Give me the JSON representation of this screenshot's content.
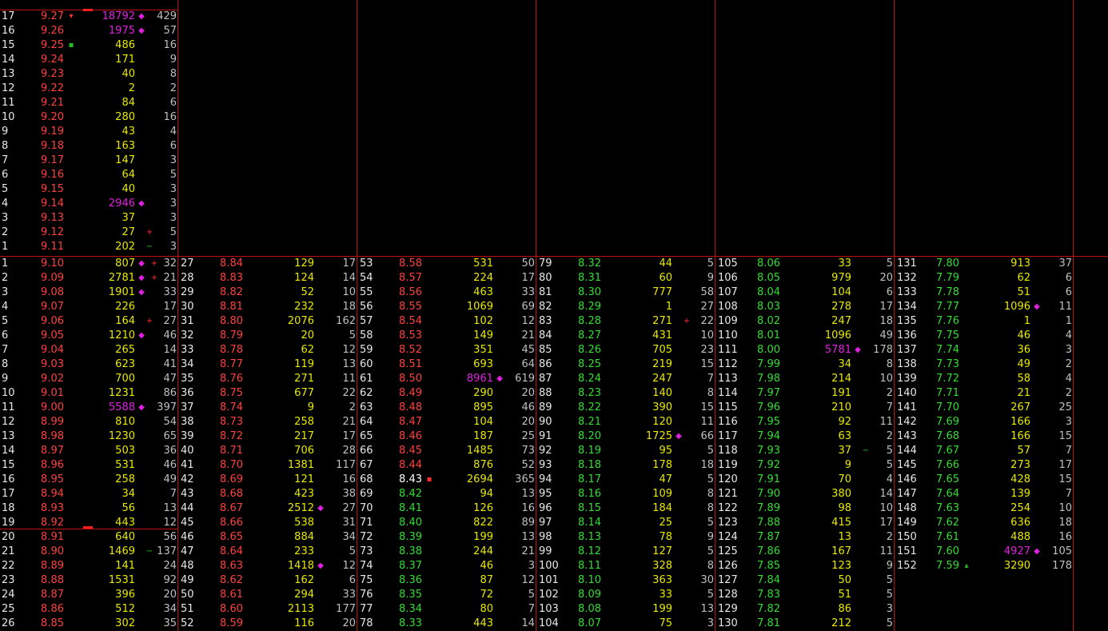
{
  "colors": {
    "up": "#ff4040",
    "down": "#33dd33",
    "neutral": "#ffffff",
    "volume": "#e8e800",
    "big_volume": "#e020e0",
    "grid": "#c01010"
  },
  "top_block": [
    {
      "i": "17",
      "p": "9.27",
      "v": "18792",
      "n": "429",
      "pm": "▾",
      "vm": "◆",
      "vc": "m"
    },
    {
      "i": "16",
      "p": "9.26",
      "v": "1975",
      "n": "57",
      "pm": "",
      "vm": "◆",
      "vc": "m"
    },
    {
      "i": "15",
      "p": "9.25",
      "v": "486",
      "n": "16",
      "pm": "▪",
      "pmc": "g",
      "vm": ""
    },
    {
      "i": "14",
      "p": "9.24",
      "v": "171",
      "n": "9"
    },
    {
      "i": "13",
      "p": "9.23",
      "v": "40",
      "n": "8"
    },
    {
      "i": "12",
      "p": "9.22",
      "v": "2",
      "n": "2"
    },
    {
      "i": "11",
      "p": "9.21",
      "v": "84",
      "n": "6"
    },
    {
      "i": "10",
      "p": "9.20",
      "v": "280",
      "n": "16"
    },
    {
      "i": "9",
      "p": "9.19",
      "v": "43",
      "n": "4"
    },
    {
      "i": "8",
      "p": "9.18",
      "v": "163",
      "n": "6"
    },
    {
      "i": "7",
      "p": "9.17",
      "v": "147",
      "n": "3"
    },
    {
      "i": "6",
      "p": "9.16",
      "v": "64",
      "n": "5"
    },
    {
      "i": "5",
      "p": "9.15",
      "v": "40",
      "n": "3"
    },
    {
      "i": "4",
      "p": "9.14",
      "v": "2946",
      "n": "3",
      "vm": "◆",
      "vc": "m"
    },
    {
      "i": "3",
      "p": "9.13",
      "v": "37",
      "n": "3"
    },
    {
      "i": "2",
      "p": "9.12",
      "v": "27",
      "n": "5",
      "m2": "+",
      "m2c": "r"
    },
    {
      "i": "1",
      "p": "9.11",
      "v": "202",
      "n": "3",
      "m2": "−",
      "m2c": "g"
    }
  ],
  "columns": [
    [
      {
        "i": "1",
        "p": "9.10",
        "v": "807",
        "n": "32",
        "vm": "◆",
        "m2": "+",
        "m2c": "r"
      },
      {
        "i": "2",
        "p": "9.09",
        "v": "2781",
        "n": "21",
        "vm": "◆",
        "m2": "+",
        "m2c": "r"
      },
      {
        "i": "3",
        "p": "9.08",
        "v": "1901",
        "n": "33",
        "vm": "◆"
      },
      {
        "i": "4",
        "p": "9.07",
        "v": "226",
        "n": "17"
      },
      {
        "i": "5",
        "p": "9.06",
        "v": "164",
        "n": "27",
        "m2": "+",
        "m2c": "r"
      },
      {
        "i": "6",
        "p": "9.05",
        "v": "1210",
        "n": "46",
        "vm": "◆"
      },
      {
        "i": "7",
        "p": "9.04",
        "v": "265",
        "n": "14"
      },
      {
        "i": "8",
        "p": "9.03",
        "v": "623",
        "n": "41"
      },
      {
        "i": "9",
        "p": "9.02",
        "v": "700",
        "n": "47"
      },
      {
        "i": "10",
        "p": "9.01",
        "v": "1231",
        "n": "86"
      },
      {
        "i": "11",
        "p": "9.00",
        "v": "5588",
        "n": "397",
        "vm": "◆",
        "vc": "m"
      },
      {
        "i": "12",
        "p": "8.99",
        "v": "810",
        "n": "54"
      },
      {
        "i": "13",
        "p": "8.98",
        "v": "1230",
        "n": "65"
      },
      {
        "i": "14",
        "p": "8.97",
        "v": "503",
        "n": "36"
      },
      {
        "i": "15",
        "p": "8.96",
        "v": "531",
        "n": "46"
      },
      {
        "i": "16",
        "p": "8.95",
        "v": "258",
        "n": "49"
      },
      {
        "i": "17",
        "p": "8.94",
        "v": "34",
        "n": "7"
      },
      {
        "i": "18",
        "p": "8.93",
        "v": "56",
        "n": "13"
      },
      {
        "i": "19",
        "p": "8.92",
        "v": "443",
        "n": "12"
      },
      {
        "i": "20",
        "p": "8.91",
        "v": "640",
        "n": "56"
      },
      {
        "i": "21",
        "p": "8.90",
        "v": "1469",
        "n": "137",
        "m2": "−",
        "m2c": "g"
      },
      {
        "i": "22",
        "p": "8.89",
        "v": "141",
        "n": "24"
      },
      {
        "i": "23",
        "p": "8.88",
        "v": "1531",
        "n": "92"
      },
      {
        "i": "24",
        "p": "8.87",
        "v": "396",
        "n": "20"
      },
      {
        "i": "25",
        "p": "8.86",
        "v": "512",
        "n": "34"
      },
      {
        "i": "26",
        "p": "8.85",
        "v": "302",
        "n": "35"
      }
    ],
    [
      {
        "i": "27",
        "p": "8.84",
        "v": "129",
        "n": "17"
      },
      {
        "i": "28",
        "p": "8.83",
        "v": "124",
        "n": "14"
      },
      {
        "i": "29",
        "p": "8.82",
        "v": "52",
        "n": "10"
      },
      {
        "i": "30",
        "p": "8.81",
        "v": "232",
        "n": "18"
      },
      {
        "i": "31",
        "p": "8.80",
        "v": "2076",
        "n": "162"
      },
      {
        "i": "32",
        "p": "8.79",
        "v": "20",
        "n": "5"
      },
      {
        "i": "33",
        "p": "8.78",
        "v": "62",
        "n": "12"
      },
      {
        "i": "34",
        "p": "8.77",
        "v": "119",
        "n": "13"
      },
      {
        "i": "35",
        "p": "8.76",
        "v": "271",
        "n": "11"
      },
      {
        "i": "36",
        "p": "8.75",
        "v": "677",
        "n": "22"
      },
      {
        "i": "37",
        "p": "8.74",
        "v": "9",
        "n": "2"
      },
      {
        "i": "38",
        "p": "8.73",
        "v": "258",
        "n": "21"
      },
      {
        "i": "39",
        "p": "8.72",
        "v": "217",
        "n": "17"
      },
      {
        "i": "40",
        "p": "8.71",
        "v": "706",
        "n": "28"
      },
      {
        "i": "41",
        "p": "8.70",
        "v": "1381",
        "n": "117"
      },
      {
        "i": "42",
        "p": "8.69",
        "v": "121",
        "n": "16"
      },
      {
        "i": "43",
        "p": "8.68",
        "v": "423",
        "n": "38"
      },
      {
        "i": "44",
        "p": "8.67",
        "v": "2512",
        "n": "27",
        "vm": "◆"
      },
      {
        "i": "45",
        "p": "8.66",
        "v": "538",
        "n": "31"
      },
      {
        "i": "46",
        "p": "8.65",
        "v": "884",
        "n": "34"
      },
      {
        "i": "47",
        "p": "8.64",
        "v": "233",
        "n": "5"
      },
      {
        "i": "48",
        "p": "8.63",
        "v": "1418",
        "n": "12",
        "vm": "◆"
      },
      {
        "i": "49",
        "p": "8.62",
        "v": "162",
        "n": "6"
      },
      {
        "i": "50",
        "p": "8.61",
        "v": "294",
        "n": "33"
      },
      {
        "i": "51",
        "p": "8.60",
        "v": "2113",
        "n": "177"
      },
      {
        "i": "52",
        "p": "8.59",
        "v": "116",
        "n": "20"
      }
    ],
    [
      {
        "i": "53",
        "p": "8.58",
        "v": "531",
        "n": "50"
      },
      {
        "i": "54",
        "p": "8.57",
        "v": "224",
        "n": "17"
      },
      {
        "i": "55",
        "p": "8.56",
        "v": "463",
        "n": "33"
      },
      {
        "i": "56",
        "p": "8.55",
        "v": "1069",
        "n": "69"
      },
      {
        "i": "57",
        "p": "8.54",
        "v": "102",
        "n": "12"
      },
      {
        "i": "58",
        "p": "8.53",
        "v": "149",
        "n": "21"
      },
      {
        "i": "59",
        "p": "8.52",
        "v": "351",
        "n": "45"
      },
      {
        "i": "60",
        "p": "8.51",
        "v": "693",
        "n": "64"
      },
      {
        "i": "61",
        "p": "8.50",
        "v": "8961",
        "n": "619",
        "vm": "◆",
        "vc": "m"
      },
      {
        "i": "62",
        "p": "8.49",
        "v": "290",
        "n": "20"
      },
      {
        "i": "63",
        "p": "8.48",
        "v": "895",
        "n": "46"
      },
      {
        "i": "64",
        "p": "8.47",
        "v": "104",
        "n": "20"
      },
      {
        "i": "65",
        "p": "8.46",
        "v": "187",
        "n": "25"
      },
      {
        "i": "66",
        "p": "8.45",
        "v": "1485",
        "n": "73"
      },
      {
        "i": "67",
        "p": "8.44",
        "v": "876",
        "n": "52"
      },
      {
        "i": "68",
        "p": "8.43",
        "v": "2694",
        "n": "365",
        "pc": "w",
        "pm": "▪",
        "pmc": "r"
      },
      {
        "i": "69",
        "p": "8.42",
        "v": "94",
        "n": "13",
        "pc": "g"
      },
      {
        "i": "70",
        "p": "8.41",
        "v": "126",
        "n": "16",
        "pc": "g"
      },
      {
        "i": "71",
        "p": "8.40",
        "v": "822",
        "n": "89",
        "pc": "g"
      },
      {
        "i": "72",
        "p": "8.39",
        "v": "199",
        "n": "13",
        "pc": "g"
      },
      {
        "i": "73",
        "p": "8.38",
        "v": "244",
        "n": "21",
        "pc": "g"
      },
      {
        "i": "74",
        "p": "8.37",
        "v": "46",
        "n": "3",
        "pc": "g"
      },
      {
        "i": "75",
        "p": "8.36",
        "v": "87",
        "n": "12",
        "pc": "g"
      },
      {
        "i": "76",
        "p": "8.35",
        "v": "72",
        "n": "5",
        "pc": "g"
      },
      {
        "i": "77",
        "p": "8.34",
        "v": "80",
        "n": "7",
        "pc": "g"
      },
      {
        "i": "78",
        "p": "8.33",
        "v": "443",
        "n": "14",
        "pc": "g"
      }
    ],
    [
      {
        "i": "79",
        "p": "8.32",
        "v": "44",
        "n": "5",
        "pc": "g"
      },
      {
        "i": "80",
        "p": "8.31",
        "v": "60",
        "n": "9",
        "pc": "g"
      },
      {
        "i": "81",
        "p": "8.30",
        "v": "777",
        "n": "58",
        "pc": "g"
      },
      {
        "i": "82",
        "p": "8.29",
        "v": "1",
        "n": "27",
        "pc": "g"
      },
      {
        "i": "83",
        "p": "8.28",
        "v": "271",
        "n": "22",
        "pc": "g",
        "m2": "+",
        "m2c": "r"
      },
      {
        "i": "84",
        "p": "8.27",
        "v": "431",
        "n": "10",
        "pc": "g"
      },
      {
        "i": "85",
        "p": "8.26",
        "v": "705",
        "n": "23",
        "pc": "g"
      },
      {
        "i": "86",
        "p": "8.25",
        "v": "219",
        "n": "15",
        "pc": "g"
      },
      {
        "i": "87",
        "p": "8.24",
        "v": "247",
        "n": "7",
        "pc": "g"
      },
      {
        "i": "88",
        "p": "8.23",
        "v": "140",
        "n": "8",
        "pc": "g"
      },
      {
        "i": "89",
        "p": "8.22",
        "v": "390",
        "n": "15",
        "pc": "g"
      },
      {
        "i": "90",
        "p": "8.21",
        "v": "120",
        "n": "11",
        "pc": "g"
      },
      {
        "i": "91",
        "p": "8.20",
        "v": "1725",
        "n": "66",
        "pc": "g",
        "vm": "◆"
      },
      {
        "i": "92",
        "p": "8.19",
        "v": "95",
        "n": "5",
        "pc": "g"
      },
      {
        "i": "93",
        "p": "8.18",
        "v": "178",
        "n": "18",
        "pc": "g"
      },
      {
        "i": "94",
        "p": "8.17",
        "v": "47",
        "n": "5",
        "pc": "g"
      },
      {
        "i": "95",
        "p": "8.16",
        "v": "109",
        "n": "8",
        "pc": "g"
      },
      {
        "i": "96",
        "p": "8.15",
        "v": "184",
        "n": "8",
        "pc": "g"
      },
      {
        "i": "97",
        "p": "8.14",
        "v": "25",
        "n": "5",
        "pc": "g"
      },
      {
        "i": "98",
        "p": "8.13",
        "v": "78",
        "n": "9",
        "pc": "g"
      },
      {
        "i": "99",
        "p": "8.12",
        "v": "127",
        "n": "5",
        "pc": "g"
      },
      {
        "i": "100",
        "p": "8.11",
        "v": "328",
        "n": "8",
        "pc": "g"
      },
      {
        "i": "101",
        "p": "8.10",
        "v": "363",
        "n": "30",
        "pc": "g"
      },
      {
        "i": "102",
        "p": "8.09",
        "v": "33",
        "n": "5",
        "pc": "g"
      },
      {
        "i": "103",
        "p": "8.08",
        "v": "199",
        "n": "13",
        "pc": "g"
      },
      {
        "i": "104",
        "p": "8.07",
        "v": "75",
        "n": "3",
        "pc": "g"
      }
    ],
    [
      {
        "i": "105",
        "p": "8.06",
        "v": "33",
        "n": "5",
        "pc": "g"
      },
      {
        "i": "106",
        "p": "8.05",
        "v": "979",
        "n": "20",
        "pc": "g"
      },
      {
        "i": "107",
        "p": "8.04",
        "v": "104",
        "n": "6",
        "pc": "g"
      },
      {
        "i": "108",
        "p": "8.03",
        "v": "278",
        "n": "17",
        "pc": "g"
      },
      {
        "i": "109",
        "p": "8.02",
        "v": "247",
        "n": "18",
        "pc": "g"
      },
      {
        "i": "110",
        "p": "8.01",
        "v": "1096",
        "n": "49",
        "pc": "g"
      },
      {
        "i": "111",
        "p": "8.00",
        "v": "5781",
        "n": "178",
        "pc": "g",
        "vm": "◆",
        "vc": "m"
      },
      {
        "i": "112",
        "p": "7.99",
        "v": "34",
        "n": "8",
        "pc": "g"
      },
      {
        "i": "113",
        "p": "7.98",
        "v": "214",
        "n": "10",
        "pc": "g"
      },
      {
        "i": "114",
        "p": "7.97",
        "v": "191",
        "n": "2",
        "pc": "g"
      },
      {
        "i": "115",
        "p": "7.96",
        "v": "210",
        "n": "7",
        "pc": "g"
      },
      {
        "i": "116",
        "p": "7.95",
        "v": "92",
        "n": "11",
        "pc": "g"
      },
      {
        "i": "117",
        "p": "7.94",
        "v": "63",
        "n": "2",
        "pc": "g"
      },
      {
        "i": "118",
        "p": "7.93",
        "v": "37",
        "n": "5",
        "pc": "g",
        "m2": "−",
        "m2c": "g"
      },
      {
        "i": "119",
        "p": "7.92",
        "v": "9",
        "n": "5",
        "pc": "g"
      },
      {
        "i": "120",
        "p": "7.91",
        "v": "70",
        "n": "4",
        "pc": "g"
      },
      {
        "i": "121",
        "p": "7.90",
        "v": "380",
        "n": "14",
        "pc": "g"
      },
      {
        "i": "122",
        "p": "7.89",
        "v": "98",
        "n": "10",
        "pc": "g"
      },
      {
        "i": "123",
        "p": "7.88",
        "v": "415",
        "n": "17",
        "pc": "g"
      },
      {
        "i": "124",
        "p": "7.87",
        "v": "13",
        "n": "2",
        "pc": "g"
      },
      {
        "i": "125",
        "p": "7.86",
        "v": "167",
        "n": "11",
        "pc": "g"
      },
      {
        "i": "126",
        "p": "7.85",
        "v": "123",
        "n": "9",
        "pc": "g"
      },
      {
        "i": "127",
        "p": "7.84",
        "v": "50",
        "n": "5",
        "pc": "g"
      },
      {
        "i": "128",
        "p": "7.83",
        "v": "51",
        "n": "5",
        "pc": "g"
      },
      {
        "i": "129",
        "p": "7.82",
        "v": "86",
        "n": "3",
        "pc": "g"
      },
      {
        "i": "130",
        "p": "7.81",
        "v": "212",
        "n": "5",
        "pc": "g"
      }
    ],
    [
      {
        "i": "131",
        "p": "7.80",
        "v": "913",
        "n": "37",
        "pc": "g"
      },
      {
        "i": "132",
        "p": "7.79",
        "v": "62",
        "n": "6",
        "pc": "g"
      },
      {
        "i": "133",
        "p": "7.78",
        "v": "51",
        "n": "6",
        "pc": "g"
      },
      {
        "i": "134",
        "p": "7.77",
        "v": "1096",
        "n": "11",
        "pc": "g",
        "vm": "◆"
      },
      {
        "i": "135",
        "p": "7.76",
        "v": "1",
        "n": "1",
        "pc": "g"
      },
      {
        "i": "136",
        "p": "7.75",
        "v": "46",
        "n": "4",
        "pc": "g"
      },
      {
        "i": "137",
        "p": "7.74",
        "v": "36",
        "n": "3",
        "pc": "g"
      },
      {
        "i": "138",
        "p": "7.73",
        "v": "49",
        "n": "2",
        "pc": "g"
      },
      {
        "i": "139",
        "p": "7.72",
        "v": "58",
        "n": "4",
        "pc": "g"
      },
      {
        "i": "140",
        "p": "7.71",
        "v": "21",
        "n": "2",
        "pc": "g"
      },
      {
        "i": "141",
        "p": "7.70",
        "v": "267",
        "n": "25",
        "pc": "g"
      },
      {
        "i": "142",
        "p": "7.69",
        "v": "166",
        "n": "3",
        "pc": "g"
      },
      {
        "i": "143",
        "p": "7.68",
        "v": "166",
        "n": "15",
        "pc": "g"
      },
      {
        "i": "144",
        "p": "7.67",
        "v": "57",
        "n": "7",
        "pc": "g"
      },
      {
        "i": "145",
        "p": "7.66",
        "v": "273",
        "n": "17",
        "pc": "g"
      },
      {
        "i": "146",
        "p": "7.65",
        "v": "428",
        "n": "15",
        "pc": "g"
      },
      {
        "i": "147",
        "p": "7.64",
        "v": "139",
        "n": "7",
        "pc": "g"
      },
      {
        "i": "148",
        "p": "7.63",
        "v": "254",
        "n": "10",
        "pc": "g"
      },
      {
        "i": "149",
        "p": "7.62",
        "v": "636",
        "n": "18",
        "pc": "g"
      },
      {
        "i": "150",
        "p": "7.61",
        "v": "488",
        "n": "16",
        "pc": "g"
      },
      {
        "i": "151",
        "p": "7.60",
        "v": "4927",
        "n": "105",
        "pc": "g",
        "vm": "◆",
        "vc": "m"
      },
      {
        "i": "152",
        "p": "7.59",
        "v": "3290",
        "n": "178",
        "pc": "g",
        "pm": "▴",
        "pmc": "g"
      }
    ]
  ]
}
